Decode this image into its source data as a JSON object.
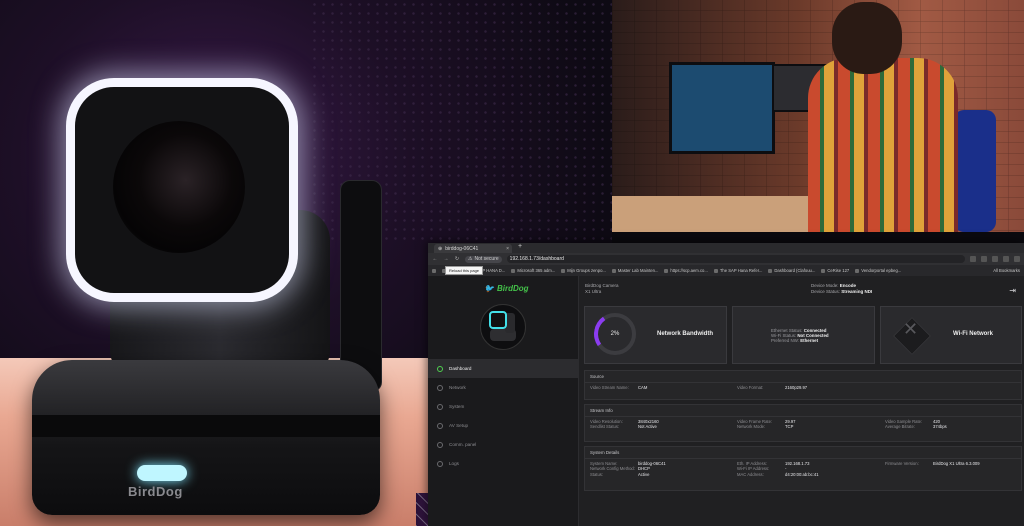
{
  "browser": {
    "tab_title": "birddog-06C41",
    "tab_close": "×",
    "new_tab": "+",
    "security_label": "Not secure",
    "url": "192.168.1.73/dashboard",
    "tooltip": "Reload this page",
    "bookmarks": [
      "AI",
      "ADMI, SAP HANA D...",
      "Microsoft 365 adm...",
      "Mijn Groups zenpo...",
      "Master Lab Mainten...",
      "https://scp.aem.co...",
      "The SAP Hana Refer...",
      "Dashboard (Clafouu...",
      "CeRise 127",
      "Vendorportal epbeg..."
    ],
    "all_bookmarks": "All Bookmarks"
  },
  "sidebar": {
    "logo_text": "BirdDog",
    "items": [
      {
        "label": "Dashboard",
        "active": true
      },
      {
        "label": "Network",
        "active": false
      },
      {
        "label": "System",
        "active": false
      },
      {
        "label": "AV Setup",
        "active": false
      },
      {
        "label": "Comm. panel",
        "active": false
      },
      {
        "label": "Logs",
        "active": false
      }
    ]
  },
  "header": {
    "device_name": "BirdDog Camera",
    "device_model": "X1 Ultra",
    "device_mode_label": "Device Mode:",
    "device_mode_value": "Encode",
    "device_status_label": "Device Status:",
    "device_status_value": "Streaming NDI"
  },
  "cards": {
    "bandwidth_percent": "2%",
    "bandwidth_fraction": 0.02,
    "bandwidth_title": "Network Bandwidth",
    "ethernet_status_label": "Ethernet Status:",
    "ethernet_status_value": "Connected",
    "wifi_status_label": "Wi-Fi Status:",
    "wifi_status_value": "Not Connected",
    "preferred_nw_label": "Preferred NW:",
    "preferred_nw_value": "Ethernet",
    "wifi_title": "Wi-Fi Network"
  },
  "source": {
    "title": "Source",
    "video_stream_name_label": "Video Stream Name:",
    "video_stream_name_value": "CAM",
    "video_format_label": "Video Format:",
    "video_format_value": "2160p29.97"
  },
  "stream_info": {
    "title": "Stream Info",
    "video_resolution_label": "Video Resolution:",
    "video_resolution_value": "3840x2160",
    "sendlist_status_label": "Sendlist Status:",
    "sendlist_status_value": "Not Active",
    "video_frame_rate_label": "Video Frame Rate:",
    "video_frame_rate_value": "29.97",
    "network_mode_label": "Network Mode:",
    "network_mode_value": "TCP",
    "video_sample_rate_label": "Video Sample Rate:",
    "video_sample_rate_value": "420",
    "average_bitrate_label": "Average Bitrate:",
    "average_bitrate_value": "374bps"
  },
  "system_details": {
    "title": "System Details",
    "system_name_label": "System Name:",
    "system_name_value": "birddog-06C41",
    "network_config_label": "Network Config Method:",
    "network_config_value": "DHCP",
    "status_label": "Status:",
    "status_value": "Active",
    "eth_ip_label": "Eth. IP Address:",
    "eth_ip_value": "192.168.1.73",
    "wifi_ip_label": "Wi-Fi IP Address:",
    "wifi_ip_value": "-",
    "mac_label": "MAC Address:",
    "mac_value": "d4:20:00:ab:bc:41",
    "firmware_label": "Firmware Version:",
    "firmware_value": "BirdDog X1 Ultra 6.3.009"
  },
  "camera_logo": "BirdDog",
  "colors": {
    "accent_green": "#44c24a",
    "gauge_purple": "#8b3cf0",
    "led_cyan": "#bff6ff"
  }
}
